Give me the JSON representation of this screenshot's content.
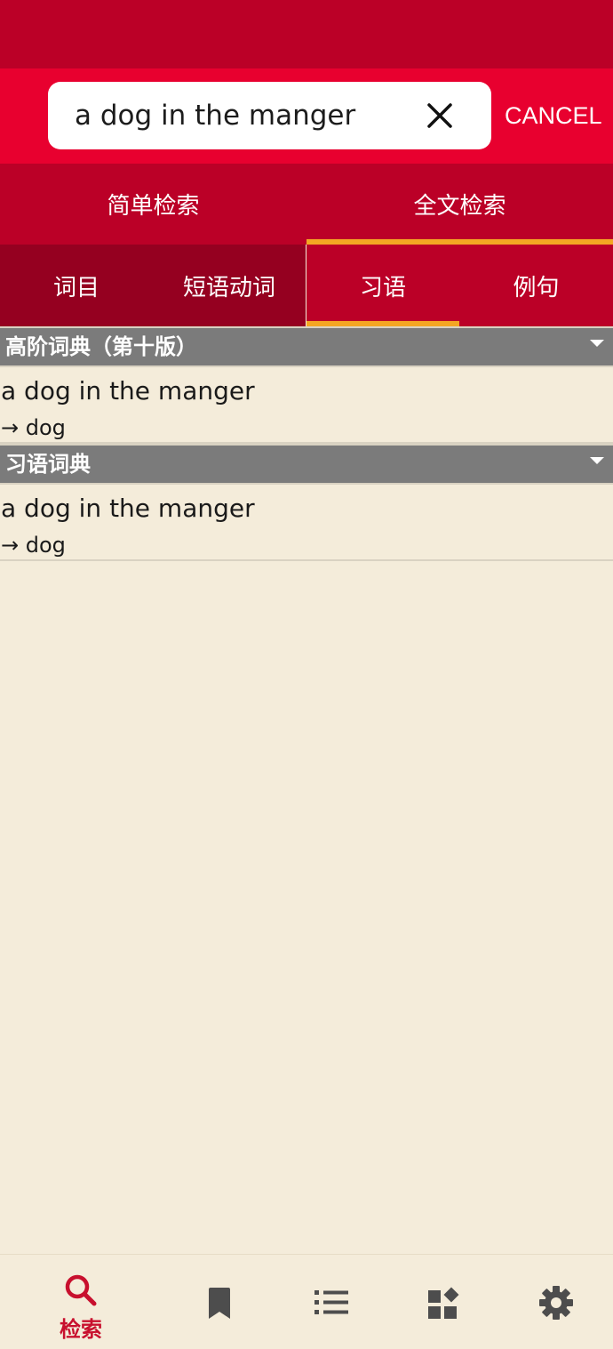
{
  "colors": {
    "status_bar": "#bb0027",
    "search_bar": "#e8002f",
    "tab_bar": "#bb0027",
    "tab_dark": "#950020",
    "indicator": "#f4a623",
    "section_header": "#7b7b7b",
    "background": "#f4ecda",
    "nav_active": "#c8102e",
    "nav_inactive": "#4d4d4d"
  },
  "search": {
    "value": "a dog in the manger",
    "clear_icon": "close-icon",
    "cancel_label": "CANCEL"
  },
  "mode_tabs": [
    {
      "label": "简单检索",
      "active": false
    },
    {
      "label": "全文检索",
      "active": true
    }
  ],
  "sub_tabs": [
    {
      "label": "词目",
      "active": false
    },
    {
      "label": "短语动词",
      "active": false
    },
    {
      "label": "习语",
      "active": true
    },
    {
      "label": "例句",
      "active": false
    }
  ],
  "sections": [
    {
      "title": "高阶词典（第十版）",
      "entries": [
        {
          "title": "a dog in the manger",
          "ref": "→ dog"
        }
      ]
    },
    {
      "title": "习语词典",
      "entries": [
        {
          "title": "a dog in the manger",
          "ref": "→ dog"
        }
      ]
    }
  ],
  "bottom_nav": [
    {
      "icon": "search-icon",
      "label": "检索",
      "active": true
    },
    {
      "icon": "bookmark-icon",
      "label": "",
      "active": false
    },
    {
      "icon": "list-icon",
      "label": "",
      "active": false
    },
    {
      "icon": "widgets-icon",
      "label": "",
      "active": false
    },
    {
      "icon": "settings-icon",
      "label": "",
      "active": false
    }
  ]
}
